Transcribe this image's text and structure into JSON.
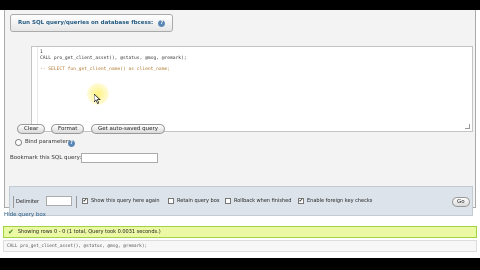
{
  "query_panel": {
    "title": "Run SQL query/queries on database fbcess:",
    "help_symbol": "?"
  },
  "editor": {
    "lines": [
      "1",
      "CALL pro_get_client_asset(), @status, @msg, @remark);",
      "-- SELECT fun_get_client_name() as client_name;"
    ]
  },
  "buttons": {
    "clear": "Clear",
    "format": "Format",
    "get_autosaved": "Get auto-saved query"
  },
  "bind_parameters": {
    "label": "Bind parameters",
    "help_symbol": "?"
  },
  "bookmark": {
    "label": "Bookmark this SQL query:",
    "value": ""
  },
  "options": {
    "delimiter_label": "Delimiter",
    "delimiter_value": "",
    "show_query_label": "Show this query here again",
    "show_query_checked": true,
    "retain_box_label": "Retain query box",
    "retain_box_checked": false,
    "rollback_label": "Rollback when finished",
    "rollback_checked": false,
    "foreign_key_label": "Enable foreign key checks",
    "foreign_key_checked": true,
    "go_label": "Go",
    "check_symbol": "✔"
  },
  "hide_query_box": "Hide query box",
  "result": {
    "check_symbol": "✔",
    "message": "Showing rows 0 - 0 (1 total, Query took 0.0031 seconds.)",
    "sql": "CALL pro_get_client_asset(), @status, @msg, @remark);"
  },
  "colors": {
    "link": "#235a81",
    "success_bg": "#ebf8a4",
    "options_bg": "#dde3ea"
  },
  "icons": {
    "help": "help-icon",
    "success": "check-icon",
    "pointer": "cursor-icon"
  }
}
